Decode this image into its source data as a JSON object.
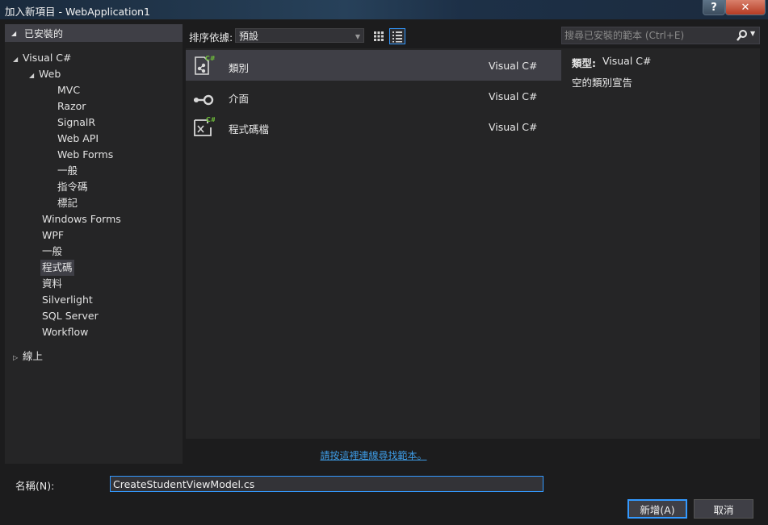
{
  "window": {
    "title": "加入新項目 - WebApplication1",
    "help_label": "?",
    "close_label": "✕"
  },
  "tree": {
    "installed_label": "已安裝的",
    "visual_csharp": "Visual C#",
    "web": "Web",
    "web_children": [
      "MVC",
      "Razor",
      "SignalR",
      "Web API",
      "Web Forms",
      "一般",
      "指令碼",
      "標記"
    ],
    "categories": [
      "Windows Forms",
      "WPF",
      "一般",
      "程式碼",
      "資料",
      "Silverlight",
      "SQL Server",
      "Workflow"
    ],
    "selected_category": "程式碼",
    "online_label": "線上"
  },
  "sort": {
    "label": "排序依據:",
    "selected": "預設"
  },
  "templates": [
    {
      "name": "類別",
      "language": "Visual C#",
      "icon": "class-icon",
      "selected": true
    },
    {
      "name": "介面",
      "language": "Visual C#",
      "icon": "interface-icon",
      "selected": false
    },
    {
      "name": "程式碼檔",
      "language": "Visual C#",
      "icon": "code-file-icon",
      "selected": false
    }
  ],
  "online_link": "請按這裡連線尋找範本。",
  "search": {
    "placeholder": "搜尋已安裝的範本 (Ctrl+E)"
  },
  "details": {
    "type_label": "類型:",
    "type_value": "Visual C#",
    "description": "空的類別宣告"
  },
  "name_field": {
    "label": "名稱(N):",
    "value": "CreateStudentViewModel.cs"
  },
  "buttons": {
    "add": "新增(A)",
    "cancel": "取消"
  },
  "colors": {
    "accent": "#3399ff",
    "link": "#3e9ce6",
    "csharp_badge": "#6fbf3a",
    "background": "#1c1c1d",
    "panel": "#252526",
    "selection": "#3f3f46"
  }
}
